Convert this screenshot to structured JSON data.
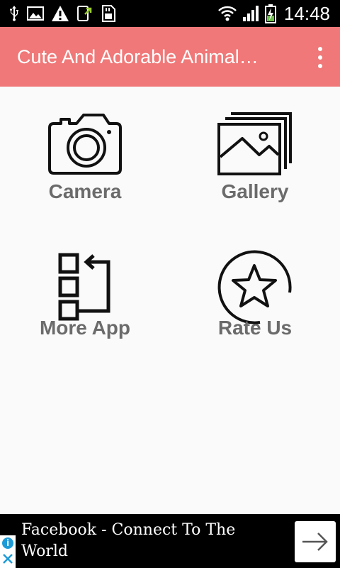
{
  "status_bar": {
    "time": "14:48",
    "icons": [
      "usb-icon",
      "image-icon",
      "warning-icon",
      "download-app-icon",
      "sd-card-icon",
      "wifi-icon",
      "signal-icon",
      "battery-charging-icon"
    ]
  },
  "app_bar": {
    "title": "Cute And Adorable Animal…",
    "background_color": "#f07878"
  },
  "menu": {
    "items": [
      {
        "id": "camera",
        "label": "Camera",
        "icon": "camera-icon"
      },
      {
        "id": "gallery",
        "label": "Gallery",
        "icon": "gallery-icon"
      },
      {
        "id": "more",
        "label": "More App",
        "icon": "more-app-icon"
      },
      {
        "id": "rate",
        "label": "Rate Us",
        "icon": "star-icon"
      }
    ],
    "label_color": "#6b6b6b"
  },
  "ad": {
    "text": "Facebook - Connect To The World",
    "info_icon": "info-icon",
    "close_icon": "close-icon",
    "cta_icon": "arrow-right-icon"
  }
}
